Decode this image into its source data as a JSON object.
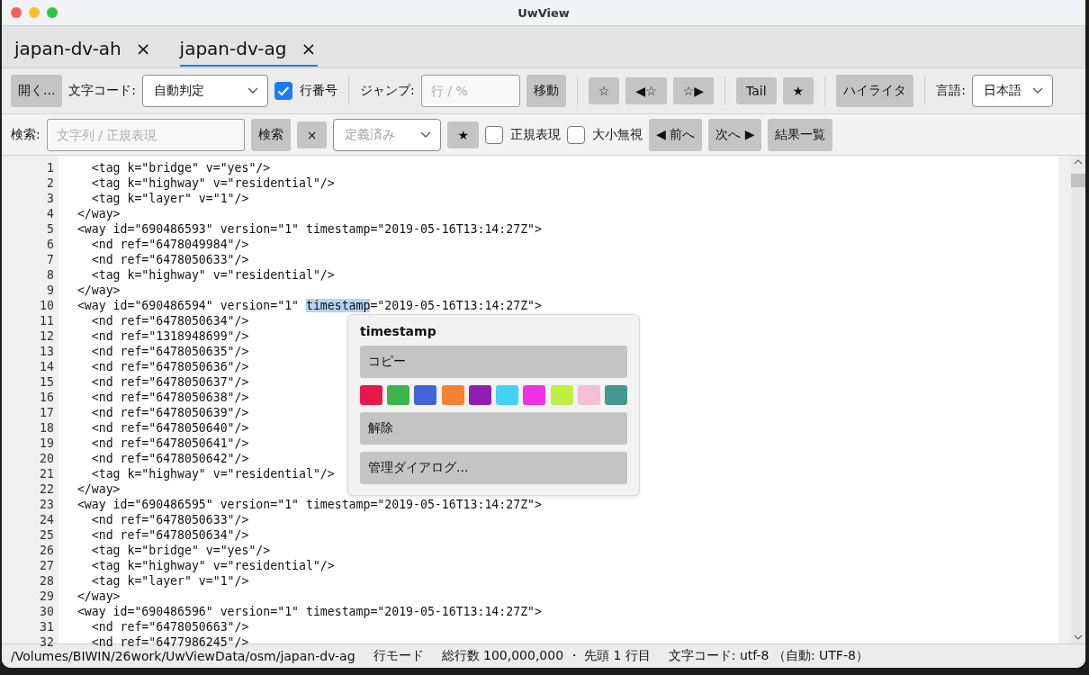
{
  "window": {
    "title": "UwView"
  },
  "tabs": [
    {
      "label": "japan-dv-ah",
      "close": "×",
      "selected": false
    },
    {
      "label": "japan-dv-ag",
      "close": "×",
      "selected": true
    }
  ],
  "toolbar": [
    {
      "kind": "button",
      "label": "開く..."
    },
    {
      "kind": "label",
      "label": "文字コード:"
    },
    {
      "kind": "select",
      "value": "自動判定"
    },
    {
      "kind": "checkbox",
      "label": "行番号",
      "checked": true
    },
    {
      "kind": "separator"
    },
    {
      "kind": "label",
      "label": "ジャンプ:"
    },
    {
      "kind": "input",
      "placeholder": "行 / %"
    },
    {
      "kind": "button",
      "label": "移動"
    },
    {
      "kind": "separator"
    },
    {
      "kind": "small",
      "label": "☆"
    },
    {
      "kind": "small",
      "label": "◀☆"
    },
    {
      "kind": "small",
      "label": "☆▶"
    },
    {
      "kind": "separator"
    },
    {
      "kind": "small",
      "label": "Tail"
    },
    {
      "kind": "small",
      "label": "★"
    },
    {
      "kind": "separator"
    },
    {
      "kind": "button",
      "label": "ハイライタ"
    },
    {
      "kind": "separator"
    },
    {
      "kind": "label",
      "label": "言語:"
    },
    {
      "kind": "select",
      "value": "日本語"
    }
  ],
  "search_bar": [
    {
      "kind": "label",
      "label": "検索:"
    },
    {
      "kind": "input",
      "placeholder": "文字列 / 正規表現"
    },
    {
      "kind": "button",
      "label": "検索"
    },
    {
      "kind": "small",
      "label": "×"
    },
    {
      "kind": "select",
      "placeholder": "定義済み"
    },
    {
      "kind": "small",
      "label": "★"
    },
    {
      "kind": "checkbox",
      "label": "正規表現",
      "checked": false
    },
    {
      "kind": "checkbox",
      "label": "大小無視",
      "checked": false
    },
    {
      "kind": "button",
      "label": "◀ 前へ"
    },
    {
      "kind": "button",
      "label": "次へ ▶"
    },
    {
      "kind": "button",
      "label": "結果一覧"
    }
  ],
  "editor": {
    "lines": [
      {
        "number": "1",
        "text": "    <tag k=\"bridge\" v=\"yes\"/>"
      },
      {
        "number": "2",
        "text": "    <tag k=\"highway\" v=\"residential\"/>"
      },
      {
        "number": "3",
        "text": "    <tag k=\"layer\" v=\"1\"/>"
      },
      {
        "number": "4",
        "text": "  </way>"
      },
      {
        "number": "5",
        "text": "  <way id=\"690486593\" version=\"1\" timestamp=\"2019-05-16T13:14:27Z\">"
      },
      {
        "number": "6",
        "text": "    <nd ref=\"6478049984\"/>"
      },
      {
        "number": "7",
        "text": "    <nd ref=\"6478050633\"/>"
      },
      {
        "number": "8",
        "text": "    <tag k=\"highway\" v=\"residential\"/>"
      },
      {
        "number": "9",
        "text": "  </way>"
      },
      {
        "number": "10",
        "text": "  <way id=\"690486594\" version=\"1\" ",
        "highlighted": "timestamp",
        "rest": "=\"2019-05-16T13:14:27Z\">"
      },
      {
        "number": "11",
        "text": "    <nd ref=\"6478050634\"/>"
      },
      {
        "number": "12",
        "text": "    <nd ref=\"1318948699\"/>"
      },
      {
        "number": "13",
        "text": "    <nd ref=\"6478050635\"/>"
      },
      {
        "number": "14",
        "text": "    <nd ref=\"6478050636\"/>"
      },
      {
        "number": "15",
        "text": "    <nd ref=\"6478050637\"/>"
      },
      {
        "number": "16",
        "text": "    <nd ref=\"6478050638\"/>"
      },
      {
        "number": "17",
        "text": "    <nd ref=\"6478050639\"/>"
      },
      {
        "number": "18",
        "text": "    <nd ref=\"6478050640\"/>"
      },
      {
        "number": "19",
        "text": "    <nd ref=\"6478050641\"/>"
      },
      {
        "number": "20",
        "text": "    <nd ref=\"6478050642\"/>"
      },
      {
        "number": "21",
        "text": "    <tag k=\"highway\" v=\"residential\"/>"
      },
      {
        "number": "22",
        "text": "  </way>"
      },
      {
        "number": "23",
        "text": "  <way id=\"690486595\" version=\"1\" timestamp=\"2019-05-16T13:14:27Z\">"
      },
      {
        "number": "24",
        "text": "    <nd ref=\"6478050633\"/>"
      },
      {
        "number": "25",
        "text": "    <nd ref=\"6478050634\"/>"
      },
      {
        "number": "26",
        "text": "    <tag k=\"bridge\" v=\"yes\"/>"
      },
      {
        "number": "27",
        "text": "    <tag k=\"highway\" v=\"residential\"/>"
      },
      {
        "number": "28",
        "text": "    <tag k=\"layer\" v=\"1\"/>"
      },
      {
        "number": "29",
        "text": "  </way>"
      },
      {
        "number": "30",
        "text": "  <way id=\"690486596\" version=\"1\" timestamp=\"2019-05-16T13:14:27Z\">"
      },
      {
        "number": "31",
        "text": "    <nd ref=\"6478050663\"/>"
      },
      {
        "number": "32",
        "text": "    <nd ref=\"6477986245\"/>"
      }
    ]
  },
  "popup": {
    "title": "timestamp",
    "copy": "コピー",
    "swatches": [
      {
        "color": "#e6194b"
      },
      {
        "color": "#3cb44b"
      },
      {
        "color": "#4363d8"
      },
      {
        "color": "#f58231"
      },
      {
        "color": "#911eb4"
      },
      {
        "color": "#42d4f4"
      },
      {
        "color": "#f032e6"
      },
      {
        "color": "#bfef45"
      },
      {
        "color": "#fabed4"
      },
      {
        "color": "#469990"
      }
    ],
    "clear": "解除",
    "manage": "管理ダイアログ..."
  },
  "status_bar": {
    "path": "/Volumes/BIWIN/26work/UwViewData/osm/japan-dv-ag",
    "mode": "行モード",
    "lines": "総行数 100,000,000 ・ 先頭 1 行目",
    "encoding": "文字コード: utf-8 （自動: UTF-8）"
  }
}
